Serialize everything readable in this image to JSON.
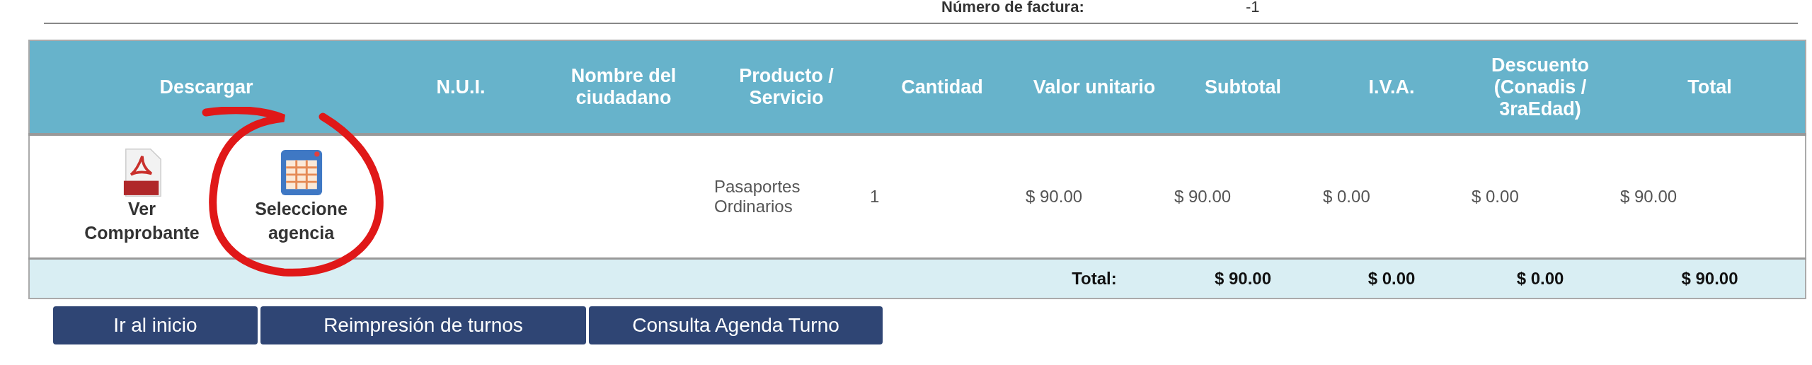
{
  "invoice": {
    "label": "Número de factura:",
    "value": "-1"
  },
  "table": {
    "columns": [
      {
        "label": "Descargar"
      },
      {
        "label": "N.U.I."
      },
      {
        "label": "Nombre del ciudadano"
      },
      {
        "label": "Producto / Servicio"
      },
      {
        "label": "Cantidad"
      },
      {
        "label": "Valor unitario"
      },
      {
        "label": "Subtotal"
      },
      {
        "label": "I.V.A."
      },
      {
        "label": "Descuento (Conadis / 3raEdad)"
      },
      {
        "label": "Total"
      }
    ],
    "rows": [
      {
        "downloads": [
          {
            "kind": "pdf",
            "label": "Ver Comprobante"
          },
          {
            "kind": "calendar",
            "label": "Seleccione agencia"
          }
        ],
        "product": "Pasaportes Ordinarios",
        "quantity": "1",
        "unit_price": "$ 90.00",
        "subtotal": "$ 90.00",
        "iva": "$ 0.00",
        "discount": "$ 0.00",
        "total": "$ 90.00"
      }
    ],
    "totals": {
      "label": "Total:",
      "subtotal": "$ 90.00",
      "iva": "$ 0.00",
      "discount": "$ 0.00",
      "total": "$ 90.00"
    }
  },
  "buttons": [
    {
      "label": "Ir al inicio"
    },
    {
      "label": "Reimpresión de turnos"
    },
    {
      "label": "Consulta Agenda Turno"
    }
  ]
}
